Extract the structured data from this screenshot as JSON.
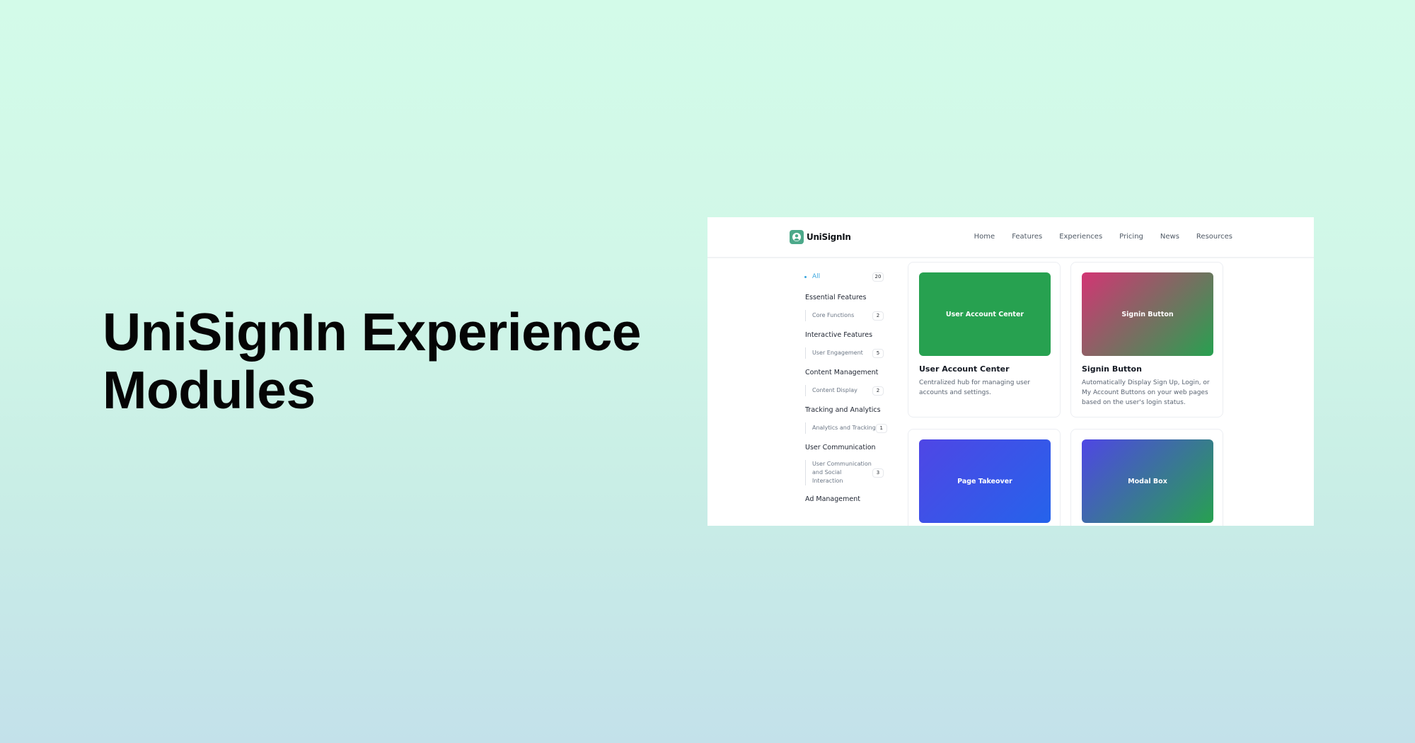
{
  "hero": {
    "title_line1": "UniSignIn Experience",
    "title_line2": "Modules"
  },
  "colors": {
    "brand": "#4ca98a",
    "active": "#3ba6de"
  },
  "app": {
    "brand_name": "UniSignIn",
    "logo_icon": "user-avatar-icon",
    "nav": [
      {
        "label": "Home"
      },
      {
        "label": "Features"
      },
      {
        "label": "Experiences"
      },
      {
        "label": "Pricing"
      },
      {
        "label": "News"
      },
      {
        "label": "Resources"
      }
    ],
    "sidebar": {
      "all": {
        "label": "All",
        "count": "20"
      },
      "groups": [
        {
          "title": "Essential Features",
          "items": [
            {
              "label": "Core Functions",
              "count": "2"
            }
          ]
        },
        {
          "title": "Interactive Features",
          "items": [
            {
              "label": "User Engagement",
              "count": "5"
            }
          ]
        },
        {
          "title": "Content Management",
          "items": [
            {
              "label": "Content Display",
              "count": "2"
            }
          ]
        },
        {
          "title": "Tracking and Analytics",
          "items": [
            {
              "label": "Analytics and Tracking",
              "count": "1"
            }
          ]
        },
        {
          "title": "User Communication",
          "items": [
            {
              "label": "User Communication and Social Interaction",
              "count": "3"
            }
          ]
        },
        {
          "title": "Ad Management",
          "items": []
        }
      ]
    },
    "cards": [
      {
        "thumb_label": "User Account Center",
        "title": "User Account Center",
        "description": "Centralized hub for managing user accounts and settings.",
        "gradient": [
          "#27a150",
          "#27a150"
        ]
      },
      {
        "thumb_label": "Signin Button",
        "title": "Signin Button",
        "description": "Automatically Display Sign Up, Login, or My Account Buttons on your web pages based on the user's login status.",
        "gradient": [
          "#d33574",
          "#27a150"
        ]
      },
      {
        "thumb_label": "Page Takeover",
        "title": "",
        "description": "",
        "gradient": [
          "#4f46e5",
          "#2563eb"
        ]
      },
      {
        "thumb_label": "Modal Box",
        "title": "",
        "description": "",
        "gradient": [
          "#4f46e5",
          "#27a150"
        ]
      }
    ]
  }
}
